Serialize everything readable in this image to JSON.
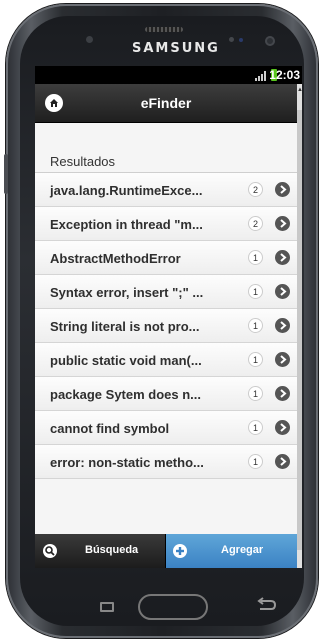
{
  "device": {
    "brand": "SAMSUNG"
  },
  "statusbar": {
    "time": "12:03"
  },
  "header": {
    "title": "eFinder"
  },
  "section": {
    "label": "Resultados"
  },
  "results": [
    {
      "label": "java.lang.RuntimeExce...",
      "count": "2"
    },
    {
      "label": "Exception in thread \"m...",
      "count": "2"
    },
    {
      "label": "AbstractMethodError",
      "count": "1"
    },
    {
      "label": "Syntax error, insert \";\" ...",
      "count": "1"
    },
    {
      "label": "String literal is not pro...",
      "count": "1"
    },
    {
      "label": "public static void man(...",
      "count": "1"
    },
    {
      "label": "package Sytem does n...",
      "count": "1"
    },
    {
      "label": "cannot find symbol",
      "count": "1"
    },
    {
      "label": "error: non-static metho...",
      "count": "1"
    }
  ],
  "footer": {
    "search_label": "Búsqueda",
    "add_label": "Agregar"
  },
  "colors": {
    "accent": "#3b82c4",
    "battery": "#58c51e",
    "header": "#1f1f1f"
  }
}
